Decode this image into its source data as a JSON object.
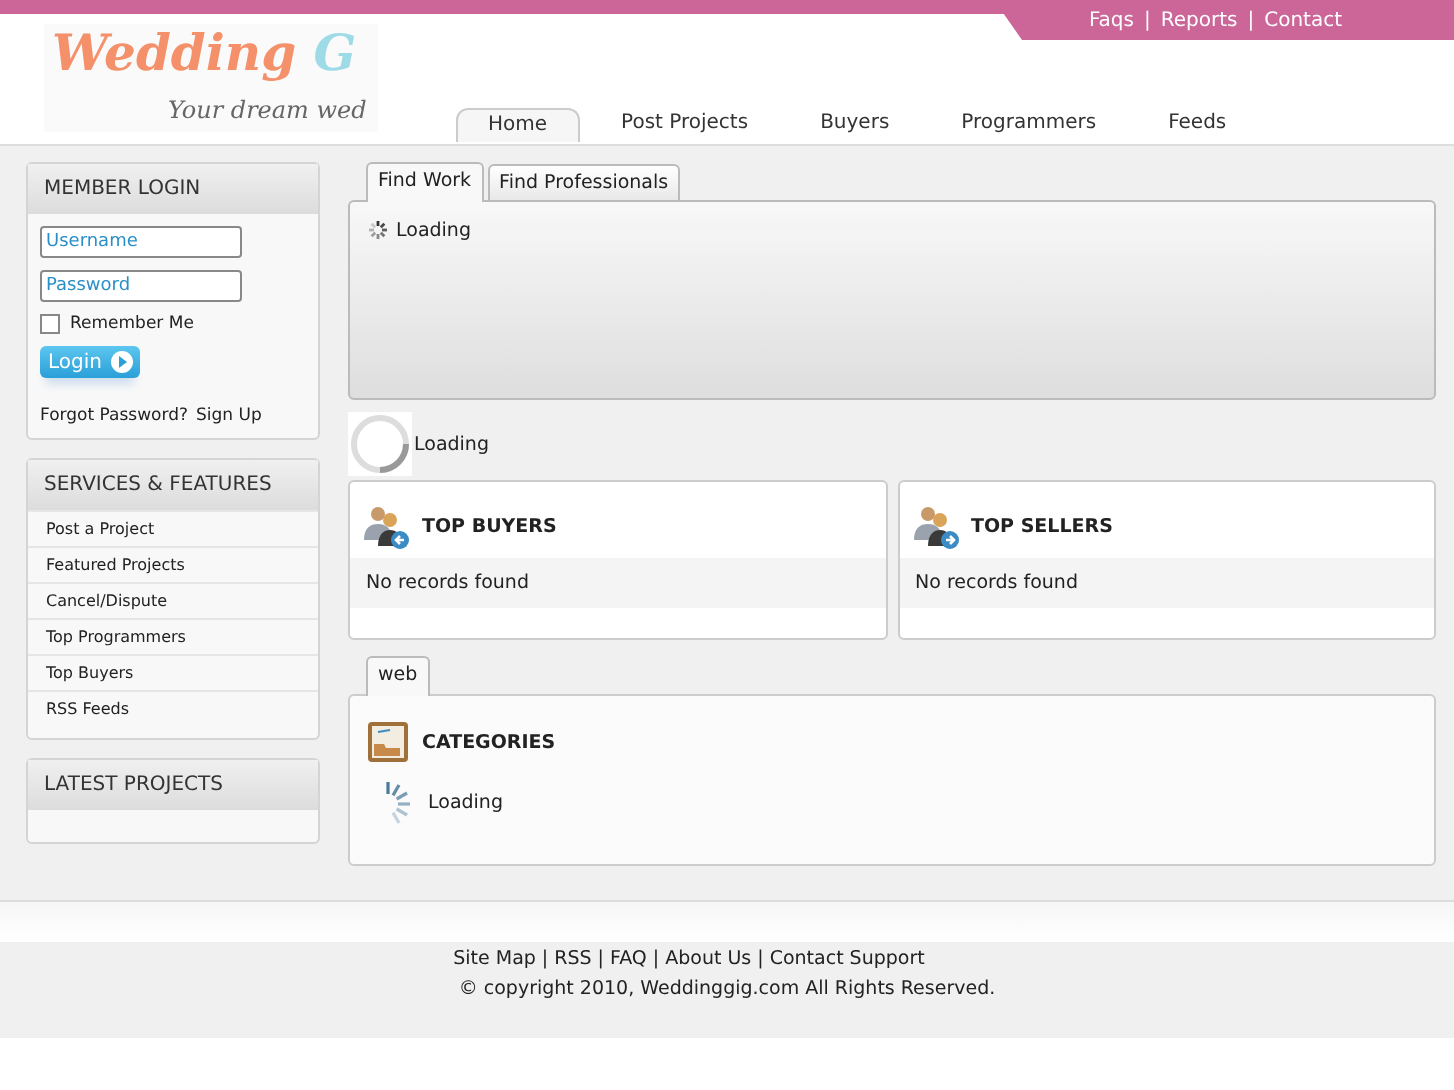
{
  "logo": {
    "title": "Wedding",
    "title_cut": "G",
    "tagline": "Your dream wed"
  },
  "top_links": [
    "Faqs",
    "|",
    "Reports",
    "|",
    "Contact"
  ],
  "nav": [
    {
      "label": "Home",
      "selected": true
    },
    {
      "label": "Post Projects",
      "selected": false
    },
    {
      "label": "Buyers",
      "selected": false
    },
    {
      "label": "Programmers",
      "selected": false
    },
    {
      "label": "Feeds",
      "selected": false
    }
  ],
  "login": {
    "title": "MEMBER LOGIN",
    "username": {
      "placeholder": "Username"
    },
    "password": {
      "placeholder": "Password"
    },
    "remember": {
      "label": "Remember Me",
      "checked": false
    },
    "button": "Login",
    "forgot": "Forgot Password?",
    "signup": "Sign Up"
  },
  "services": {
    "title": "SERVICES & FEATURES",
    "items": [
      "Post a Project",
      "Featured Projects",
      "Cancel/Dispute",
      "Top Programmers",
      "Top Buyers",
      "RSS Feeds"
    ]
  },
  "latest": {
    "title": "LATEST PROJECTS"
  },
  "work_tabs": [
    {
      "label": "Find Work",
      "selected": true
    },
    {
      "label": "Find Professionals",
      "selected": false
    }
  ],
  "work_loading": "Loading",
  "ring_loading": "Loading",
  "cards": [
    {
      "title": "TOP BUYERS",
      "kind": "buyers",
      "message": "No records found"
    },
    {
      "title": "TOP SELLERS",
      "kind": "sellers",
      "message": "No records found"
    }
  ],
  "category_tabs": [
    {
      "label": "web",
      "selected": true
    }
  ],
  "categories": {
    "title": "CATEGORIES",
    "loading": "Loading"
  },
  "footer": {
    "links": [
      "Site Map",
      "|",
      "RSS",
      "|",
      "FAQ",
      "|",
      "About Us",
      "|",
      "Contact Support"
    ],
    "copyright": "© copyright 2010, Weddinggig.com All Rights Reserved."
  }
}
